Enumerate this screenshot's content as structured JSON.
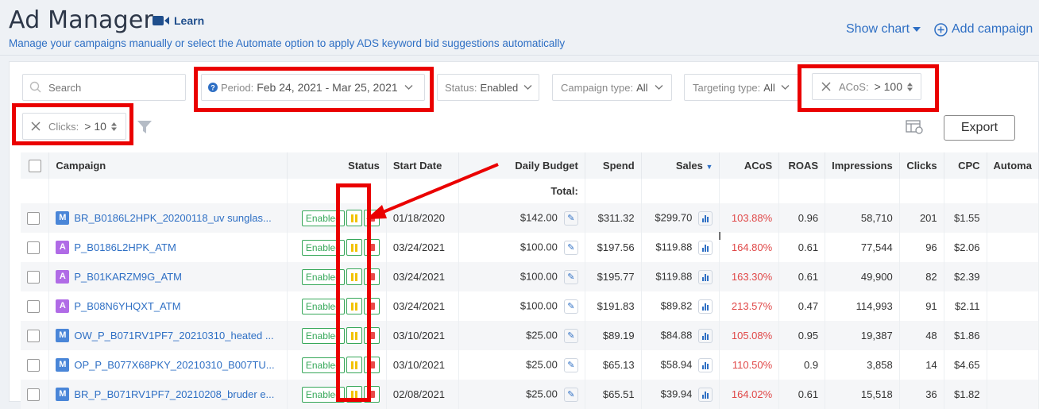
{
  "header": {
    "title": "Ad Manager",
    "learn_label": "Learn",
    "subtitle": "Manage your campaigns manually or select the Automate option to apply ADS keyword bid suggestions automatically",
    "show_chart_label": "Show chart",
    "add_campaign_label": "Add campaign"
  },
  "filters": {
    "search_placeholder": "Search",
    "period_label": "Period:",
    "period_value": "Feb 24, 2021 - Mar 25, 2021",
    "status_label": "Status:",
    "status_value": "Enabled",
    "campaign_type_label": "Campaign type:",
    "campaign_type_value": "All",
    "targeting_type_label": "Targeting type:",
    "targeting_type_value": "All",
    "acos_label": "ACoS:",
    "acos_value": "> 100",
    "clicks_label": "Clicks:",
    "clicks_value": "> 10"
  },
  "toolbar": {
    "export_label": "Export"
  },
  "table": {
    "columns": [
      "Campaign",
      "Status",
      "Start Date",
      "Daily Budget",
      "Spend",
      "Sales",
      "ACoS",
      "ROAS",
      "Impressions",
      "Clicks",
      "CPC",
      "Automa"
    ],
    "total_label": "Total:",
    "rows": [
      {
        "type": "M",
        "campaign": "BR_B0186L2HPK_20200118_uv sunglas...",
        "status": "Enabled",
        "start_date": "01/18/2020",
        "daily_budget": "$142.00",
        "spend": "$311.32",
        "sales": "$299.70",
        "acos": "103.88%",
        "roas": "0.96",
        "impressions": "58,710",
        "clicks": "201",
        "cpc": "$1.55"
      },
      {
        "type": "A",
        "campaign": "P_B0186L2HPK_ATM",
        "status": "Enabled",
        "start_date": "03/24/2021",
        "daily_budget": "$100.00",
        "spend": "$197.56",
        "sales": "$119.88",
        "acos": "164.80%",
        "roas": "0.61",
        "impressions": "77,544",
        "clicks": "96",
        "cpc": "$2.06"
      },
      {
        "type": "A",
        "campaign": "P_B01KARZM9G_ATM",
        "status": "Enabled",
        "start_date": "03/24/2021",
        "daily_budget": "$100.00",
        "spend": "$195.77",
        "sales": "$119.88",
        "acos": "163.30%",
        "roas": "0.61",
        "impressions": "49,900",
        "clicks": "82",
        "cpc": "$2.39"
      },
      {
        "type": "A",
        "campaign": "P_B08N6YHQXT_ATM",
        "status": "Enabled",
        "start_date": "03/24/2021",
        "daily_budget": "$100.00",
        "spend": "$191.83",
        "sales": "$89.82",
        "acos": "213.57%",
        "roas": "0.47",
        "impressions": "114,993",
        "clicks": "91",
        "cpc": "$2.11"
      },
      {
        "type": "M",
        "campaign": "OW_P_B071RV1PF7_20210310_heated ...",
        "status": "Enabled",
        "start_date": "03/10/2021",
        "daily_budget": "$25.00",
        "spend": "$89.19",
        "sales": "$84.88",
        "acos": "105.08%",
        "roas": "0.95",
        "impressions": "19,387",
        "clicks": "48",
        "cpc": "$1.86"
      },
      {
        "type": "M",
        "campaign": "OP_P_B077X68PKY_20210310_B007TU...",
        "status": "Enabled",
        "start_date": "03/10/2021",
        "daily_budget": "$25.00",
        "spend": "$65.13",
        "sales": "$58.94",
        "acos": "110.50%",
        "roas": "0.9",
        "impressions": "3,858",
        "clicks": "14",
        "cpc": "$4.65"
      },
      {
        "type": "M",
        "campaign": "BR_P_B071RV1PF7_20210208_bruder e...",
        "status": "Enabled",
        "start_date": "02/08/2021",
        "daily_budget": "$25.00",
        "spend": "$65.51",
        "sales": "$39.94",
        "acos": "164.02%",
        "roas": "0.61",
        "impressions": "15,518",
        "clicks": "36",
        "cpc": "$1.82"
      }
    ]
  },
  "colors": {
    "accent": "#2e6fc4",
    "annotation": "#ea0000",
    "enabled": "#37a85a",
    "acos": "#e04848"
  },
  "icons": [
    "video-icon",
    "chevron-down-icon",
    "plus-circle-icon",
    "search-icon",
    "help-icon",
    "close-icon",
    "sort-icon",
    "filter-icon",
    "column-settings-icon",
    "pause-icon",
    "trash-icon",
    "edit-icon",
    "bar-chart-icon",
    "sort-desc-icon"
  ]
}
